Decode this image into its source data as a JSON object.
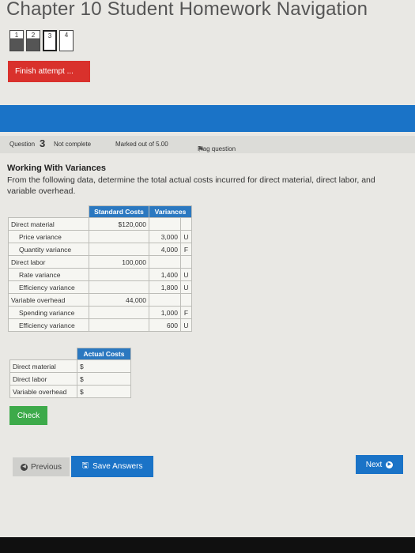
{
  "page": {
    "title": "Chapter 10 Student Homework Navigation"
  },
  "nav": {
    "blocks": [
      {
        "num": "1"
      },
      {
        "num": "2"
      },
      {
        "num": "3"
      },
      {
        "num": "4"
      }
    ]
  },
  "finish_label": "Finish attempt ...",
  "question_info": {
    "prefix": "Question",
    "number": "3",
    "status": "Not complete",
    "marked": "Marked out of 5.00",
    "flag_label": "Flag question"
  },
  "question": {
    "heading": "Working With Variances",
    "prompt": "From the following data, determine the total actual costs incurred for direct material, direct labor, and variable overhead."
  },
  "data_table": {
    "headers": {
      "standard": "Standard Costs",
      "variances": "Variances"
    },
    "rows": [
      {
        "label": "Direct material",
        "standard": "$120,000",
        "variance": "",
        "fu": ""
      },
      {
        "label": "Price variance",
        "standard": "",
        "variance": "3,000",
        "fu": "U"
      },
      {
        "label": "Quantity variance",
        "standard": "",
        "variance": "4,000",
        "fu": "F"
      },
      {
        "label": "Direct labor",
        "standard": "100,000",
        "variance": "",
        "fu": ""
      },
      {
        "label": "Rate variance",
        "standard": "",
        "variance": "1,400",
        "fu": "U"
      },
      {
        "label": "Efficiency variance",
        "standard": "",
        "variance": "1,800",
        "fu": "U"
      },
      {
        "label": "Variable overhead",
        "standard": "44,000",
        "variance": "",
        "fu": ""
      },
      {
        "label": "Spending variance",
        "standard": "",
        "variance": "1,000",
        "fu": "F"
      },
      {
        "label": "Efficiency variance",
        "standard": "",
        "variance": "600",
        "fu": "U"
      }
    ]
  },
  "actual_table": {
    "header": "Actual Costs",
    "rows": [
      {
        "label": "Direct material",
        "prefix": "$"
      },
      {
        "label": "Direct labor",
        "prefix": "$"
      },
      {
        "label": "Variable overhead",
        "prefix": "$"
      }
    ]
  },
  "buttons": {
    "check": "Check",
    "previous": "Previous",
    "save": "Save Answers",
    "next": "Next"
  },
  "colors": {
    "accent": "#1a73c7",
    "finish": "#d9312c",
    "check": "#3daa4a"
  }
}
